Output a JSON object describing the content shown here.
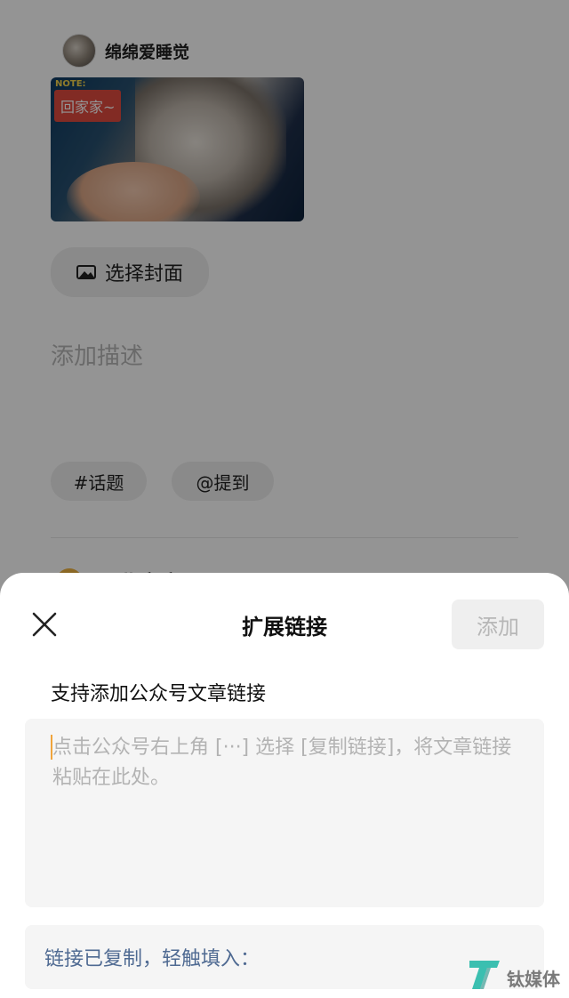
{
  "post": {
    "author": "绵绵爱睡觉",
    "cover_note": "NOTE:",
    "cover_badge": "回家家~",
    "choose_cover_label": "选择封面",
    "description_placeholder": "添加描述",
    "topic_label": "#话题",
    "mention_label": "@提到",
    "peek_text": "一北京市"
  },
  "sheet": {
    "title": "扩展链接",
    "add_label": "添加",
    "subtitle": "支持添加公众号文章链接",
    "input_placeholder": "点击公众号右上角 [···] 选择 [复制链接]，将文章链接粘贴在此处。",
    "paste_hint": "链接已复制，轻触填入："
  },
  "watermark": {
    "text": "钛媒体"
  },
  "icons": {
    "close": "close-icon",
    "cover": "image-icon",
    "watermark": "tmtpost-logo-icon"
  },
  "colors": {
    "caret": "#f0a43b",
    "link_text": "#4f6a92",
    "disabled_button": "#efefef",
    "overlay": "rgba(0,0,0,0.42)"
  }
}
